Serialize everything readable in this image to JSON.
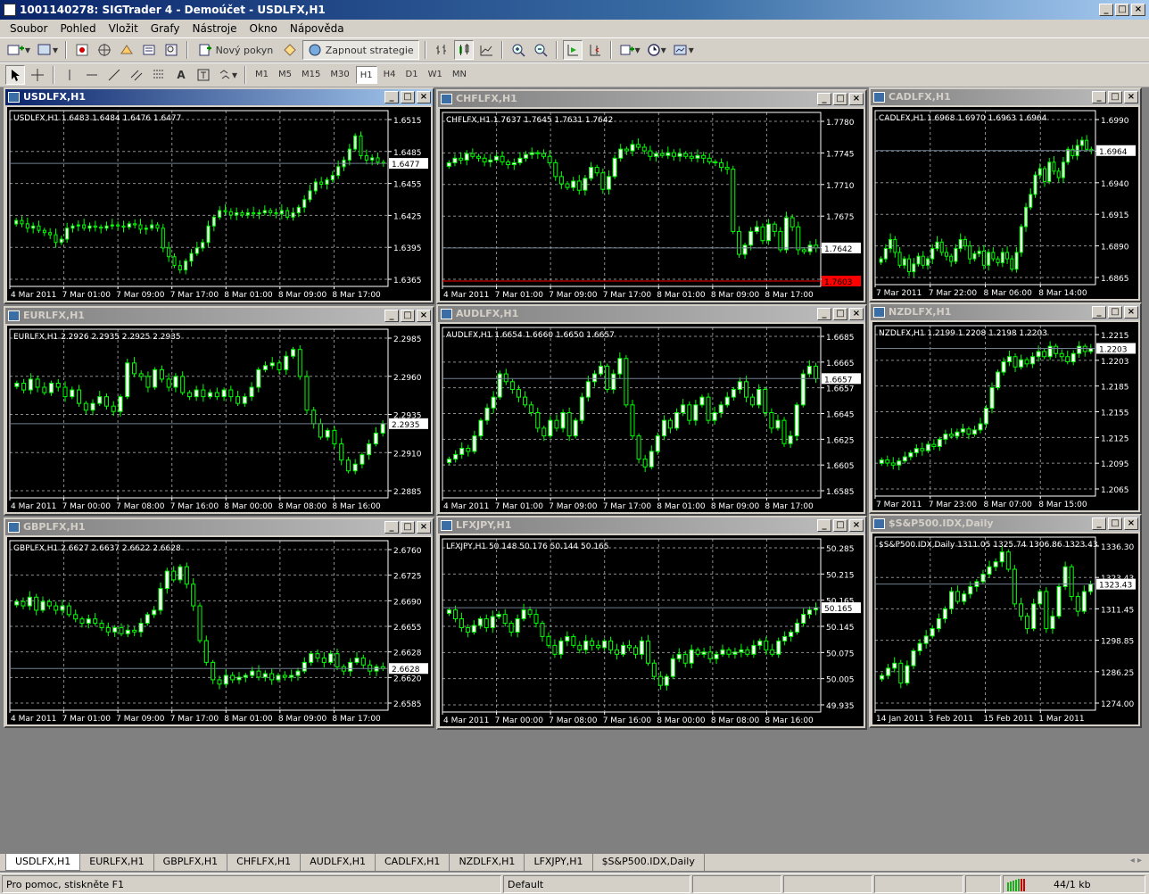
{
  "window": {
    "title": "1001140278: SIGTrader 4 - Demoúčet - USDLFX,H1"
  },
  "menu": [
    "Soubor",
    "Pohled",
    "Vložit",
    "Grafy",
    "Nástroje",
    "Okno",
    "Nápověda"
  ],
  "toolbar": {
    "new_order": "Nový pokyn",
    "strategy": "Zapnout strategie"
  },
  "timeframes": [
    "M1",
    "M5",
    "M15",
    "M30",
    "H1",
    "H4",
    "D1",
    "W1",
    "MN"
  ],
  "active_timeframe": "H1",
  "colors": {
    "bull": "#ffffff",
    "bear": "#000000",
    "wick": "#00ff00",
    "grid": "#ffffff",
    "bid_line": "#708090",
    "ask_line": "#ff0000"
  },
  "charts": [
    {
      "id": "usdlfx",
      "title": "USDLFX,H1",
      "active": true,
      "ohlc": "USDLFX,H1  1.6483 1.6484 1.6476 1.6477",
      "price_labels": [
        "1.6515",
        "1.6485",
        "1.6455",
        "1.6425",
        "1.6395",
        "1.6365"
      ],
      "bid": "1.6477",
      "time_labels": [
        "4 Mar 2011",
        "7 Mar 01:00",
        "7 Mar 09:00",
        "7 Mar 17:00",
        "8 Mar 01:00",
        "8 Mar 09:00",
        "8 Mar 17:00"
      ],
      "chart_data": {
        "type": "candlestick",
        "ylim": [
          1.6365,
          1.6525
        ],
        "closes": [
          1.6425,
          1.6422,
          1.6418,
          1.642,
          1.6416,
          1.6414,
          1.6412,
          1.6405,
          1.6408,
          1.6418,
          1.642,
          1.6421,
          1.6418,
          1.642,
          1.6419,
          1.6418,
          1.642,
          1.6421,
          1.642,
          1.6419,
          1.6422,
          1.6421,
          1.6417,
          1.6418,
          1.6421,
          1.6418,
          1.64,
          1.6392,
          1.6384,
          1.638,
          1.6388,
          1.6395,
          1.64,
          1.6405,
          1.642,
          1.6428,
          1.6434,
          1.6433,
          1.643,
          1.6432,
          1.643,
          1.6432,
          1.6431,
          1.6432,
          1.6434,
          1.6432,
          1.6431,
          1.6434,
          1.6428,
          1.6432,
          1.6437,
          1.6444,
          1.6452,
          1.646,
          1.6458,
          1.6462,
          1.6466,
          1.6474,
          1.648,
          1.649,
          1.6502,
          1.6484,
          1.648,
          1.6482,
          1.6478,
          1.6477
        ]
      }
    },
    {
      "id": "chflfx",
      "title": "CHFLFX,H1",
      "active": false,
      "ohlc": "CHFLFX,H1  1.7637 1.7645 1.7631 1.7642",
      "price_labels": [
        "1.7780",
        "1.7745",
        "1.7710",
        "1.7675",
        "1.7642",
        "1.7603"
      ],
      "bid": "1.7642",
      "ask": "1.7603",
      "time_labels": [
        "4 Mar 2011",
        "7 Mar 01:00",
        "7 Mar 09:00",
        "7 Mar 17:00",
        "8 Mar 01:00",
        "8 Mar 09:00",
        "8 Mar 17:00"
      ],
      "chart_data": {
        "type": "candlestick",
        "ylim": [
          1.76,
          1.779
        ],
        "closes": [
          1.7735,
          1.774,
          1.7738,
          1.7745,
          1.7742,
          1.774,
          1.7736,
          1.7738,
          1.7742,
          1.7736,
          1.7733,
          1.7735,
          1.774,
          1.7744,
          1.7746,
          1.7745,
          1.7742,
          1.7735,
          1.772,
          1.7712,
          1.7708,
          1.7715,
          1.7705,
          1.7718,
          1.773,
          1.7724,
          1.7706,
          1.772,
          1.774,
          1.775,
          1.7748,
          1.7755,
          1.7752,
          1.7748,
          1.7742,
          1.7745,
          1.7743,
          1.7746,
          1.7742,
          1.7745,
          1.7742,
          1.774,
          1.7743,
          1.774,
          1.7736,
          1.7735,
          1.773,
          1.7728,
          1.766,
          1.7635,
          1.7645,
          1.766,
          1.7665,
          1.765,
          1.7668,
          1.766,
          1.764,
          1.7675,
          1.7665,
          1.764,
          1.7638,
          1.7645,
          1.7642
        ]
      }
    },
    {
      "id": "cadlfx",
      "title": "CADLFX,H1",
      "active": false,
      "ohlc": "CADLFX,H1  1.6968 1.6970 1.6963 1.6964",
      "price_labels": [
        "1.6990",
        "1.6964",
        "1.6940",
        "1.6915",
        "1.6890",
        "1.6865"
      ],
      "bid": "1.6964",
      "time_labels": [
        "7 Mar 2011",
        "7 Mar 22:00",
        "8 Mar 06:00",
        "8 Mar 14:00"
      ],
      "chart_data": {
        "type": "candlestick",
        "ylim": [
          1.686,
          1.6995
        ],
        "closes": [
          1.688,
          1.6888,
          1.6895,
          1.6885,
          1.6875,
          1.688,
          1.687,
          1.6876,
          1.6882,
          1.6875,
          1.688,
          1.6888,
          1.6893,
          1.6885,
          1.6882,
          1.6878,
          1.6888,
          1.6895,
          1.689,
          1.688,
          1.6884,
          1.6886,
          1.6875,
          1.6885,
          1.688,
          1.6877,
          1.6885,
          1.688,
          1.6872,
          1.6885,
          1.6905,
          1.692,
          1.693,
          1.6945,
          1.695,
          1.694,
          1.6955,
          1.6948,
          1.6943,
          1.6955,
          1.6965,
          1.696,
          1.6968,
          1.6972,
          1.6965,
          1.6964
        ]
      }
    },
    {
      "id": "eurlfx",
      "title": "EURLFX,H1",
      "active": false,
      "ohlc": "EURLFX,H1  2.2926 2.2935 2.2925 2.2935",
      "price_labels": [
        "2.2985",
        "2.2960",
        "2.2935",
        "2.2910",
        "2.2885"
      ],
      "bid": "2.2935",
      "time_labels": [
        "4 Mar 2011",
        "7 Mar 00:00",
        "7 Mar 08:00",
        "7 Mar 16:00",
        "8 Mar 00:00",
        "8 Mar 08:00",
        "8 Mar 16:00"
      ],
      "chart_data": {
        "type": "candlestick",
        "ylim": [
          2.288,
          2.3005
        ],
        "closes": [
          2.2965,
          2.296,
          2.2968,
          2.2962,
          2.2958,
          2.2965,
          2.2962,
          2.2955,
          2.296,
          2.295,
          2.2945,
          2.295,
          2.2955,
          2.2948,
          2.2944,
          2.2955,
          2.298,
          2.2972,
          2.297,
          2.2962,
          2.2975,
          2.2968,
          2.2962,
          2.297,
          2.2958,
          2.2955,
          2.296,
          2.2955,
          2.2958,
          2.2955,
          2.296,
          2.2955,
          2.295,
          2.2955,
          2.2962,
          2.2975,
          2.2978,
          2.298,
          2.2975,
          2.2985,
          2.299,
          2.297,
          2.2945,
          2.2935,
          2.2925,
          2.293,
          2.292,
          2.2908,
          2.29,
          2.2905,
          2.2912,
          2.292,
          2.2928,
          2.2935
        ]
      }
    },
    {
      "id": "audlfx",
      "title": "AUDLFX,H1",
      "active": false,
      "ohlc": "AUDLFX,H1  1.6654 1.6660 1.6650 1.6657",
      "price_labels": [
        "1.6685",
        "1.6665",
        "1.6657",
        "1.6645",
        "1.6625",
        "1.6605",
        "1.6585"
      ],
      "bid": "1.6657",
      "time_labels": [
        "4 Mar 2011",
        "7 Mar 01:00",
        "7 Mar 09:00",
        "7 Mar 17:00",
        "8 Mar 01:00",
        "8 Mar 09:00",
        "8 Mar 17:00"
      ],
      "chart_data": {
        "type": "candlestick",
        "ylim": [
          1.658,
          1.669
        ],
        "closes": [
          1.6605,
          1.6608,
          1.6612,
          1.661,
          1.662,
          1.663,
          1.6638,
          1.6645,
          1.666,
          1.6655,
          1.665,
          1.6645,
          1.664,
          1.6635,
          1.6625,
          1.662,
          1.663,
          1.6625,
          1.6635,
          1.662,
          1.663,
          1.6645,
          1.6655,
          1.666,
          1.6665,
          1.665,
          1.666,
          1.667,
          1.664,
          1.662,
          1.6605,
          1.66,
          1.661,
          1.662,
          1.663,
          1.6625,
          1.6635,
          1.664,
          1.663,
          1.664,
          1.6645,
          1.663,
          1.6635,
          1.664,
          1.6645,
          1.665,
          1.6655,
          1.6645,
          1.664,
          1.665,
          1.6635,
          1.6625,
          1.663,
          1.6615,
          1.662,
          1.664,
          1.666,
          1.6665,
          1.6657
        ]
      }
    },
    {
      "id": "nzdlfx",
      "title": "NZDLFX,H1",
      "active": false,
      "ohlc": "NZDLFX,H1  1.2199 1.2208 1.2198 1.2203",
      "price_labels": [
        "1.2215",
        "1.2203",
        "1.2185",
        "1.2155",
        "1.2125",
        "1.2095",
        "1.2065"
      ],
      "bid": "1.2203",
      "time_labels": [
        "7 Mar 2011",
        "7 Mar 23:00",
        "8 Mar 07:00",
        "8 Mar 15:00"
      ],
      "chart_data": {
        "type": "candlestick",
        "ylim": [
          1.206,
          1.2225
        ],
        "closes": [
          1.2095,
          1.2092,
          1.209,
          1.2094,
          1.2098,
          1.2102,
          1.2106,
          1.2104,
          1.211,
          1.2108,
          1.2115,
          1.212,
          1.2118,
          1.2122,
          1.2125,
          1.212,
          1.2124,
          1.213,
          1.2145,
          1.2165,
          1.218,
          1.219,
          1.2195,
          1.2185,
          1.2192,
          1.2188,
          1.2195,
          1.22,
          1.2195,
          1.2205,
          1.2198,
          1.2195,
          1.219,
          1.2198,
          1.2205,
          1.22,
          1.2203
        ]
      }
    },
    {
      "id": "gbplfx",
      "title": "GBPLFX,H1",
      "active": false,
      "ohlc": "GBPLFX,H1  2.6627 2.6637 2.6622 2.6628",
      "price_labels": [
        "2.6760",
        "2.6725",
        "2.6690",
        "2.6655",
        "2.6628",
        "2.6620",
        "2.6585"
      ],
      "bid": "2.6628",
      "time_labels": [
        "4 Mar 2011",
        "7 Mar 01:00",
        "7 Mar 09:00",
        "7 Mar 17:00",
        "8 Mar 01:00",
        "8 Mar 09:00",
        "8 Mar 17:00"
      ],
      "chart_data": {
        "type": "candlestick",
        "ylim": [
          2.658,
          2.6775
        ],
        "closes": [
          2.6705,
          2.67,
          2.671,
          2.6695,
          2.6705,
          2.67,
          2.6695,
          2.67,
          2.669,
          2.6685,
          2.668,
          2.6685,
          2.668,
          2.6675,
          2.667,
          2.6675,
          2.6668,
          2.6672,
          2.667,
          2.668,
          2.669,
          2.6695,
          2.672,
          2.674,
          2.673,
          2.6745,
          2.6725,
          2.67,
          2.666,
          2.6635,
          2.6615,
          2.661,
          2.662,
          2.6615,
          2.6618,
          2.662,
          2.6625,
          2.6618,
          2.6622,
          2.6615,
          2.662,
          2.6618,
          2.662,
          2.6625,
          2.6635,
          2.6645,
          2.664,
          2.6635,
          2.6645,
          2.663,
          2.6625,
          2.6635,
          2.664,
          2.6632,
          2.6625,
          2.663,
          2.6628
        ]
      }
    },
    {
      "id": "lfxjpy",
      "title": "LFXJPY,H1",
      "active": false,
      "ohlc": "LFXJPY,H1  50.148 50.176 50.144 50.165",
      "price_labels": [
        "50.285",
        "50.215",
        "50.165",
        "50.145",
        "50.075",
        "50.005",
        "49.935"
      ],
      "bid": "50.165",
      "time_labels": [
        "4 Mar 2011",
        "7 Mar 00:00",
        "7 Mar 08:00",
        "7 Mar 16:00",
        "8 Mar 00:00",
        "8 Mar 08:00",
        "8 Mar 16:00"
      ],
      "chart_data": {
        "type": "candlestick",
        "ylim": [
          49.93,
          50.32
        ],
        "closes": [
          50.16,
          50.14,
          50.12,
          50.11,
          50.125,
          50.14,
          50.12,
          50.145,
          50.15,
          50.13,
          50.11,
          50.14,
          50.16,
          50.15,
          50.13,
          50.1,
          50.08,
          50.06,
          50.09,
          50.1,
          50.08,
          50.07,
          50.09,
          50.08,
          50.075,
          50.09,
          50.07,
          50.06,
          50.08,
          50.075,
          50.06,
          50.09,
          50.04,
          50.01,
          49.99,
          50.01,
          50.05,
          50.06,
          50.04,
          50.07,
          50.06,
          50.065,
          50.05,
          50.06,
          50.07,
          50.06,
          50.065,
          50.07,
          50.06,
          50.08,
          50.09,
          50.07,
          50.06,
          50.09,
          50.1,
          50.11,
          50.13,
          50.15,
          50.16,
          50.165
        ]
      }
    },
    {
      "id": "sp500",
      "title": "$S&P500.IDX,Daily",
      "active": false,
      "ohlc": "$S&P500.IDX,Daily  1311.05 1325.74 1306.86 1323.43",
      "price_labels": [
        "1336.30",
        "1323.43",
        "1311.45",
        "1298.85",
        "1286.25",
        "1274.00"
      ],
      "bid": "1323.43",
      "time_labels": [
        "14 Jan 2011",
        "3 Feb 2011",
        "15 Feb 2011",
        "1 Mar 2011"
      ],
      "chart_data": {
        "type": "candlestick",
        "ylim": [
          1272,
          1342
        ],
        "closes": [
          1286,
          1289,
          1291,
          1283,
          1290,
          1296,
          1299,
          1302,
          1305,
          1309,
          1313,
          1320,
          1316,
          1319,
          1322,
          1324,
          1327,
          1330,
          1332,
          1336,
          1329,
          1315,
          1310,
          1305,
          1315,
          1320,
          1305,
          1310,
          1322,
          1330,
          1318,
          1312,
          1320,
          1323
        ]
      }
    }
  ],
  "tabs": [
    "USDLFX,H1",
    "EURLFX,H1",
    "GBPLFX,H1",
    "CHFLFX,H1",
    "AUDLFX,H1",
    "CADLFX,H1",
    "NZDLFX,H1",
    "LFXJPY,H1",
    "$S&P500.IDX,Daily"
  ],
  "active_tab": "USDLFX,H1",
  "status": {
    "help": "Pro pomoc, stiskněte F1",
    "profile": "Default",
    "traffic": "44/1 kb"
  }
}
